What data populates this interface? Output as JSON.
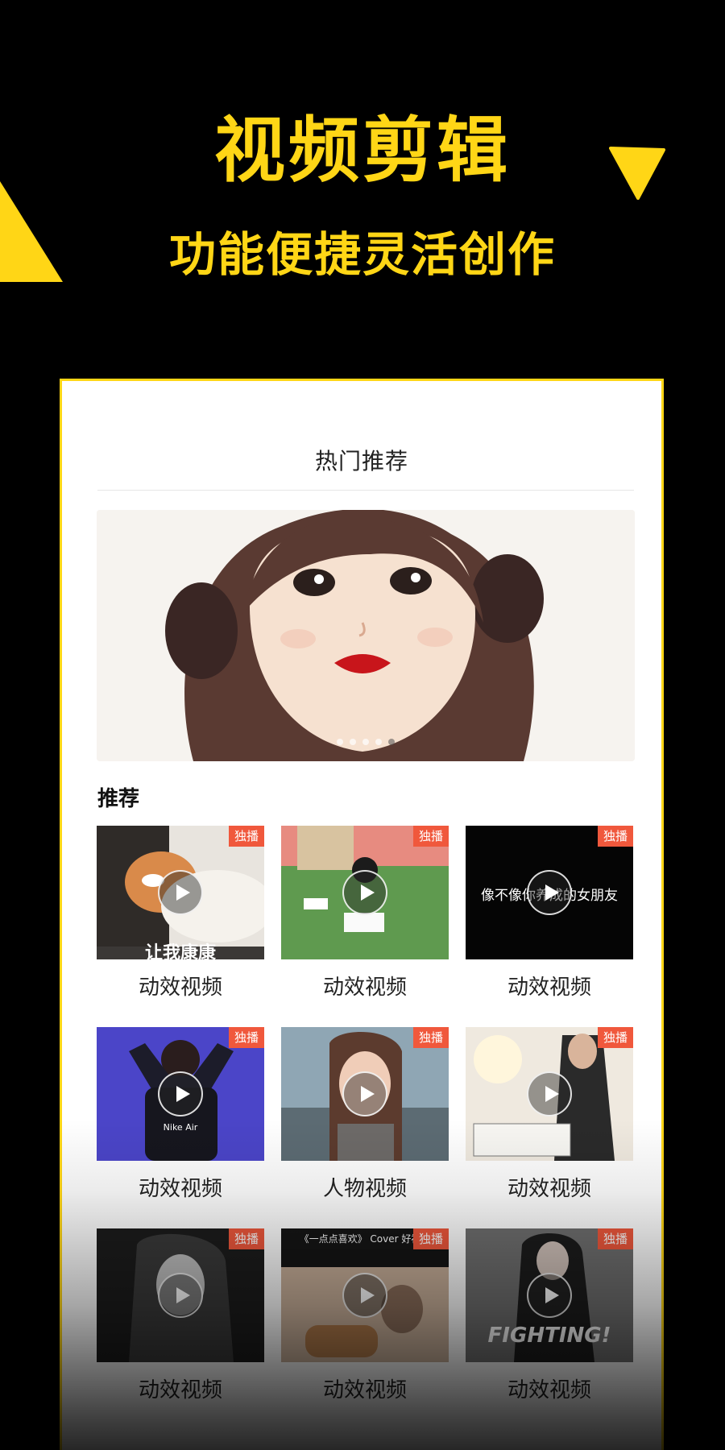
{
  "promo": {
    "headline": "视频剪辑",
    "subheadline": "功能便捷灵活创作",
    "accent_color": "#FFD616"
  },
  "screen": {
    "title": "热门推荐",
    "banner": {
      "dot_count": 5,
      "active_dot": 4
    },
    "section_title": "推荐",
    "badge_color": "#F0583C",
    "videos": [
      {
        "label": "动效视频",
        "badge": "独播",
        "caption": "让我康康",
        "icon": "play-icon"
      },
      {
        "label": "动效视频",
        "badge": "独播",
        "caption": "",
        "icon": "play-icon"
      },
      {
        "label": "动效视频",
        "badge": "独播",
        "caption": "像不像你养成的女朋友",
        "icon": "play-icon"
      },
      {
        "label": "动效视频",
        "badge": "独播",
        "caption": "Nike Air",
        "icon": "play-icon"
      },
      {
        "label": "人物视频",
        "badge": "独播",
        "caption": "",
        "icon": "play-icon"
      },
      {
        "label": "动效视频",
        "badge": "独播",
        "caption": "",
        "icon": "play-icon"
      },
      {
        "label": "动效视频",
        "badge": "独播",
        "caption": "",
        "icon": "play-icon"
      },
      {
        "label": "动效视频",
        "badge": "独播",
        "caption": "《一点点喜欢》 Cover 好福如",
        "icon": "play-icon"
      },
      {
        "label": "动效视频",
        "badge": "独播",
        "caption": "FIGHTING!",
        "icon": "play-icon"
      }
    ]
  }
}
